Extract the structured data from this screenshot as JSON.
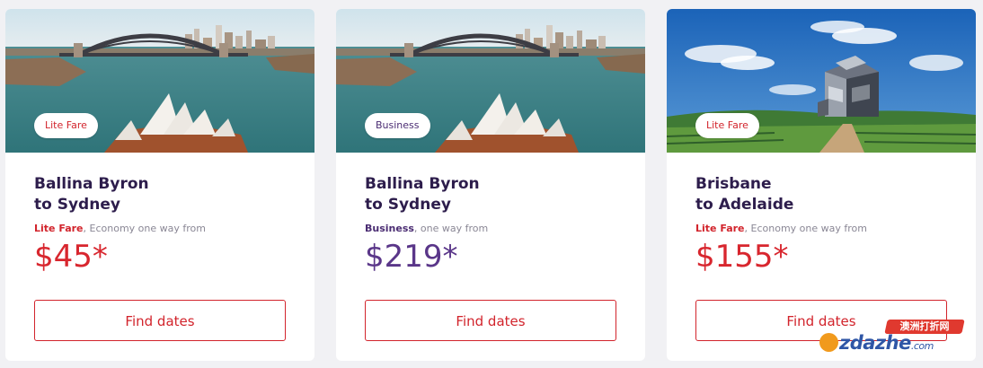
{
  "cards": [
    {
      "badge": "Lite Fare",
      "title_line1": "Ballina Byron",
      "title_line2": "to Sydney",
      "fare_name": "Lite Fare",
      "fare_suffix": ", Economy one way from",
      "price": "$45*",
      "button": "Find dates",
      "image": "sydney-harbour-image"
    },
    {
      "badge": "Business",
      "title_line1": "Ballina Byron",
      "title_line2": "to Sydney",
      "fare_name": "Business",
      "fare_suffix": ", one way from",
      "price": "$219*",
      "button": "Find dates",
      "image": "sydney-harbour-image"
    },
    {
      "badge": "Lite Fare",
      "title_line1": "Brisbane",
      "title_line2": "to Adelaide",
      "fare_name": "Lite Fare",
      "fare_suffix": ", Economy one way from",
      "price": "$155*",
      "button": "Find dates",
      "image": "adelaide-vineyard-cube-image"
    }
  ],
  "watermark": {
    "cn_text": "澳洲打折网",
    "brand": "zdazhe",
    "tld": ".com"
  },
  "colors": {
    "lite_red": "#d8262e",
    "business_purple": "#5a3689",
    "title_purple": "#2d1d4c",
    "page_bg": "#f1f1f4"
  }
}
